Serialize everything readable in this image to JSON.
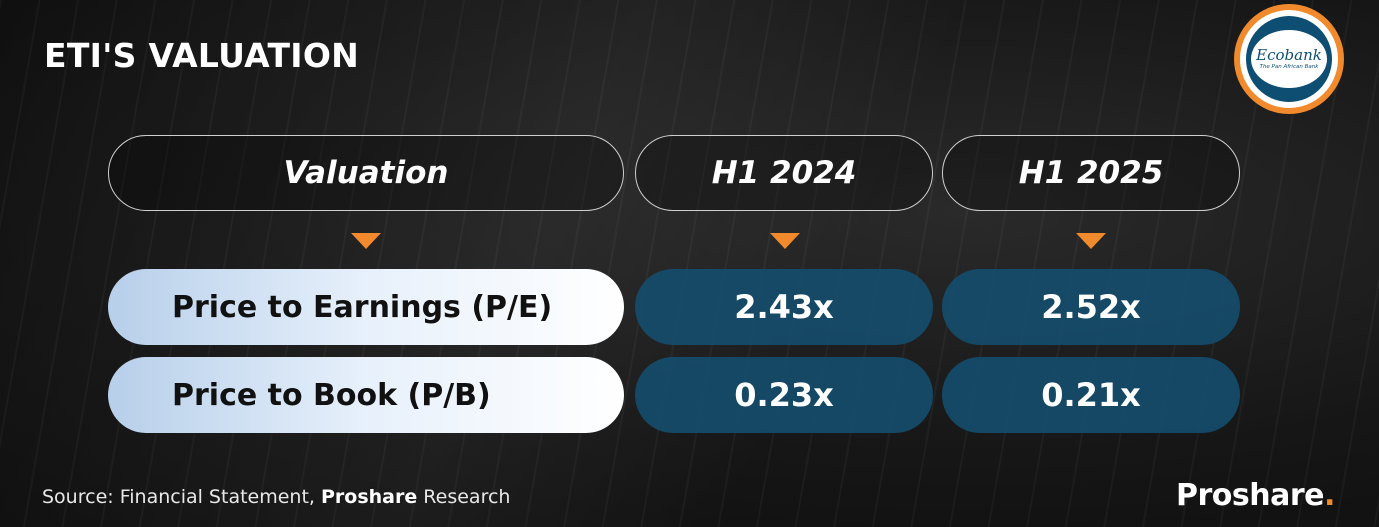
{
  "title": "ETI'S VALUATION",
  "logo": {
    "name": "Ecobank",
    "tagline": "The Pan African Bank"
  },
  "columns": [
    "Valuation",
    "H1 2024",
    "H1 2025"
  ],
  "rows": [
    {
      "metric": "Price to Earnings (P/E)",
      "h1_2024": "2.43x",
      "h1_2025": "2.52x"
    },
    {
      "metric": "Price to Book (P/B)",
      "h1_2024": "0.23x",
      "h1_2025": "0.21x"
    }
  ],
  "source": {
    "prefix": "Source: Financial Statement, ",
    "brand": "Proshare",
    "suffix": " Research"
  },
  "brand": {
    "name": "Proshare",
    "dot": "."
  },
  "colors": {
    "accent": "#f08a2c",
    "value_fill": "#144e70",
    "label_fill": "#e7f0fb"
  }
}
